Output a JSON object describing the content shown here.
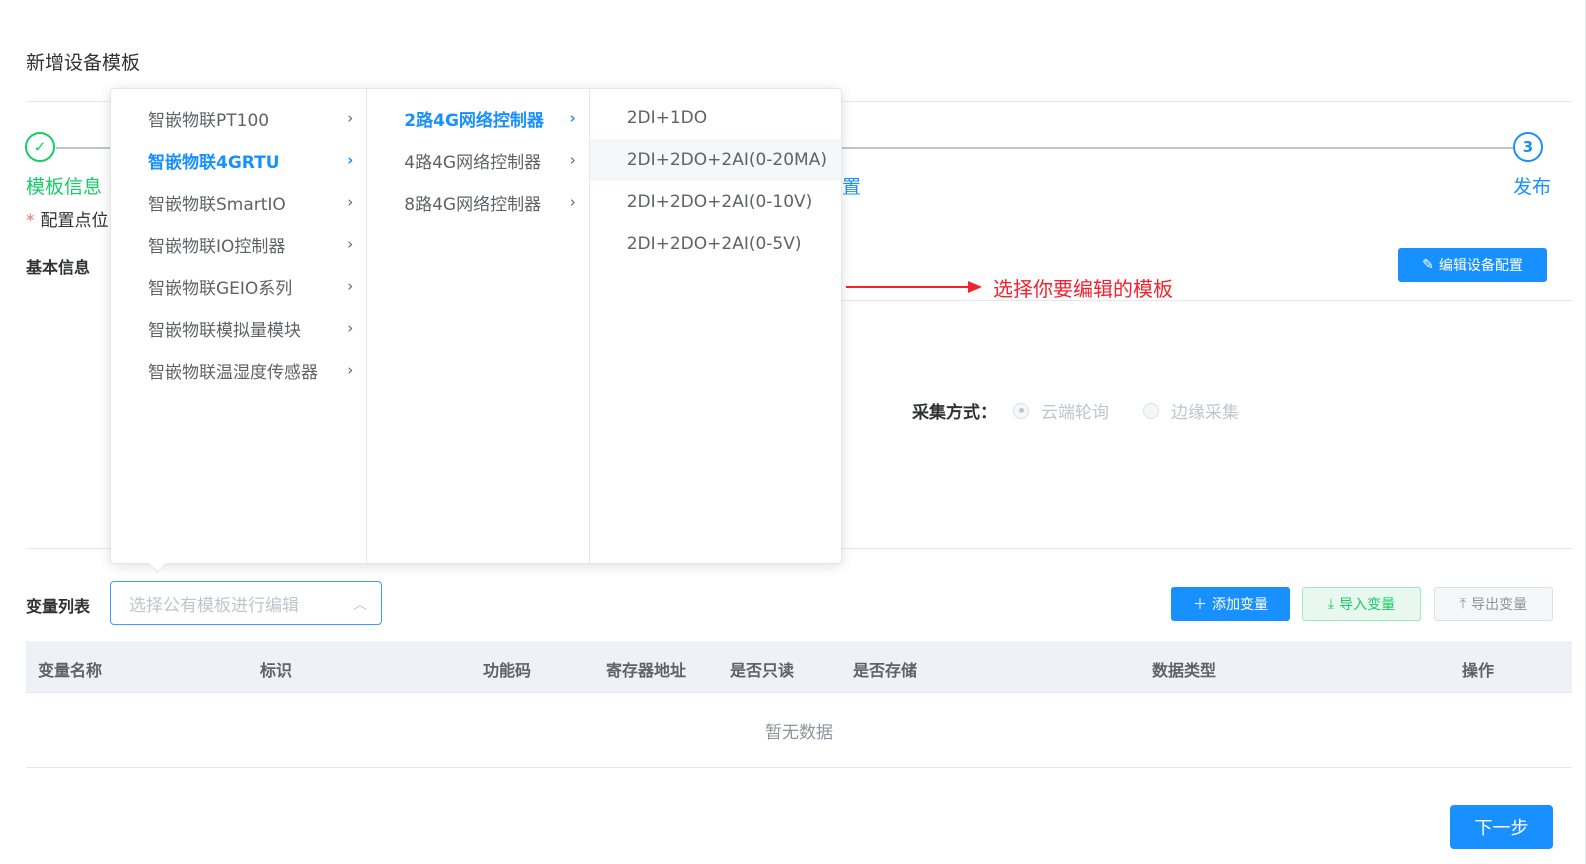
{
  "page": {
    "title": "新增设备模板"
  },
  "steps": [
    {
      "label": "模板信息",
      "status": "done"
    },
    {
      "label": "置",
      "status": "process"
    },
    {
      "label": "发布",
      "number": "3",
      "status": "wait"
    }
  ],
  "form": {
    "config_points_label": "配置点位",
    "basic_info_label": "基本信息",
    "edit_config_button": "编辑设备配置",
    "collect_label": "采集方式：",
    "radio_options": [
      {
        "label": "云端轮询",
        "checked": true
      },
      {
        "label": "边缘采集",
        "checked": false
      }
    ]
  },
  "annotation": {
    "text": "选择你要编辑的模板",
    "color": "#f5222d"
  },
  "variables": {
    "label": "变量列表",
    "select_placeholder": "选择公有模板进行编辑",
    "add_button": "添加变量",
    "import_button": "导入变量",
    "export_button": "导出变量",
    "columns": [
      "变量名称",
      "标识",
      "功能码",
      "寄存器地址",
      "是否只读",
      "是否存储",
      "数据类型",
      "操作"
    ],
    "empty_text": "暂无数据"
  },
  "next_button": "下一步",
  "cascader": {
    "level1": [
      {
        "label": "智嵌物联PT100",
        "active": false
      },
      {
        "label": "智嵌物联4GRTU",
        "active": true
      },
      {
        "label": "智嵌物联SmartIO",
        "active": false
      },
      {
        "label": "智嵌物联IO控制器",
        "active": false
      },
      {
        "label": "智嵌物联GEIO系列",
        "active": false
      },
      {
        "label": "智嵌物联模拟量模块",
        "active": false
      },
      {
        "label": "智嵌物联温湿度传感器",
        "active": false
      }
    ],
    "level2": [
      {
        "label": "2路4G网络控制器",
        "active": true
      },
      {
        "label": "4路4G网络控制器",
        "active": false
      },
      {
        "label": "8路4G网络控制器",
        "active": false
      }
    ],
    "level3": [
      {
        "label": "2DI+1DO",
        "hover": false
      },
      {
        "label": "2DI+2DO+2AI(0-20MA)",
        "hover": true
      },
      {
        "label": "2DI+2DO+2AI(0-10V)",
        "hover": false
      },
      {
        "label": "2DI+2DO+2AI(0-5V)",
        "hover": false
      }
    ]
  },
  "colors": {
    "primary": "#1890ff",
    "success": "#13ce66",
    "danger": "#f56c6c"
  }
}
